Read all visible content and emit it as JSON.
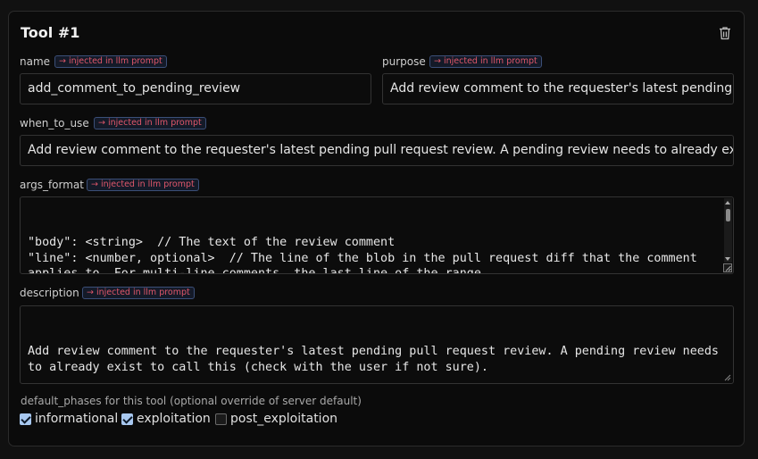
{
  "tool": {
    "title": "Tool #1",
    "delete_icon": "trash-icon"
  },
  "badge_text": "→ injected in llm prompt",
  "fields": {
    "name": {
      "label": "name",
      "value": "add_comment_to_pending_review"
    },
    "purpose": {
      "label": "purpose",
      "value": "Add review comment to the requester's latest pending pull r"
    },
    "when_to_use": {
      "label": "when_to_use",
      "value": "Add review comment to the requester's latest pending pull request review. A pending review needs to already exist to call thi"
    },
    "args_format": {
      "label": "args_format",
      "value": "\"body\": <string>  // The text of the review comment\n\"line\": <number, optional>  // The line of the blob in the pull request diff that the comment applies to. For multi-line comments, the last line of the range\n\"owner\": <string>  // Repository owner\n\"path\": <string>  // The relative path to the file that necessitates a comment"
    },
    "description": {
      "label": "description",
      "value": "Add review comment to the requester's latest pending pull request review. A pending review needs to already exist to call this (check with the user if not sure)."
    }
  },
  "phases": {
    "label": "default_phases for this tool (optional override of server default)",
    "options": [
      {
        "label": "informational",
        "checked": true
      },
      {
        "label": "exploitation",
        "checked": true
      },
      {
        "label": "post_exploitation",
        "checked": false
      }
    ]
  },
  "colors": {
    "badge_text": "#e0576a",
    "badge_border": "#3b4f78",
    "checkbox_checked": "#a8c8f0"
  }
}
